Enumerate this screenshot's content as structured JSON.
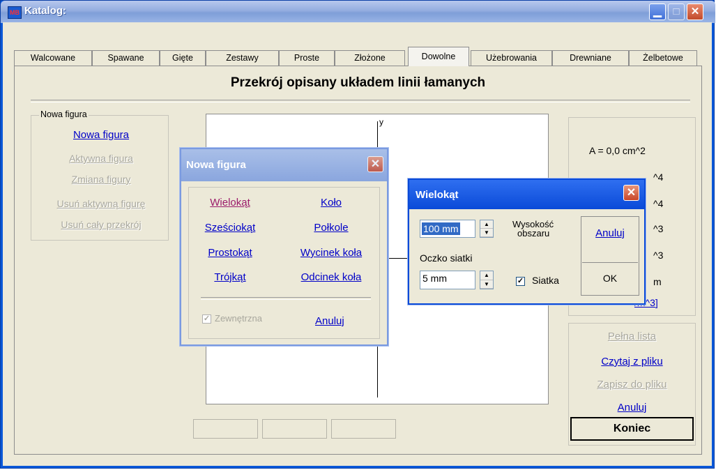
{
  "window": {
    "title": "Katalog:",
    "icon_text": "MB"
  },
  "tabs": [
    {
      "label": "Walcowane"
    },
    {
      "label": "Spawane"
    },
    {
      "label": "Gięte"
    },
    {
      "label": "Zestawy"
    },
    {
      "label": "Proste"
    },
    {
      "label": "Złożone"
    },
    {
      "label": "Dowolne",
      "active": true
    },
    {
      "label": "Użebrowania"
    },
    {
      "label": "Drewniane"
    },
    {
      "label": "Żelbetowe"
    }
  ],
  "panel": {
    "heading": "Przekrój opisany układem linii łamanych"
  },
  "left_group": {
    "legend": "Nowa figura",
    "items": [
      {
        "label": "Nowa figura",
        "enabled": true
      },
      {
        "label": "Aktywna figura",
        "enabled": false
      },
      {
        "label": "Zmiana figury",
        "enabled": false
      },
      {
        "label": "Usuń aktywną figurę",
        "enabled": false
      },
      {
        "label": "Usuń cały przekrój",
        "enabled": false
      }
    ]
  },
  "canvas": {
    "axis_label": "y"
  },
  "props": {
    "area": "A = 0,0 cm^2",
    "partial_1": "^4",
    "partial_2": "^4",
    "partial_3": "^3",
    "partial_4": "^3",
    "partial_5": "m",
    "partial_link": "/m^3]"
  },
  "actions": {
    "full_list": "Pełna lista",
    "read_file": "Czytaj z pliku",
    "save_file": "Zapisz do pliku",
    "cancel": "Anuluj",
    "end": "Koniec"
  },
  "dialog_new": {
    "title": "Nowa figura",
    "shapes": [
      {
        "label": "Wielokąt"
      },
      {
        "label": "Koło"
      },
      {
        "label": "Sześciokąt"
      },
      {
        "label": "Połkole"
      },
      {
        "label": "Prostokąt"
      },
      {
        "label": "Wycinek koła"
      },
      {
        "label": "Trójkąt"
      },
      {
        "label": "Odcinek koła"
      }
    ],
    "external_label": "Zewnętrzna",
    "external_checked": true,
    "cancel": "Anuluj"
  },
  "dialog_polygon": {
    "title": "Wielokąt",
    "height_value": "100 mm",
    "height_label_1": "Wysokość",
    "height_label_2": "obszaru",
    "grid_label": "Oczko siatki",
    "grid_value": "5 mm",
    "grid_checkbox_label": "Siatka",
    "grid_checked": true,
    "cancel": "Anuluj",
    "ok": "OK"
  },
  "colors": {
    "titlebar": "#0b58d8",
    "link": "#0000c8",
    "disabled": "#a8a79d",
    "background": "#ece9d8"
  }
}
